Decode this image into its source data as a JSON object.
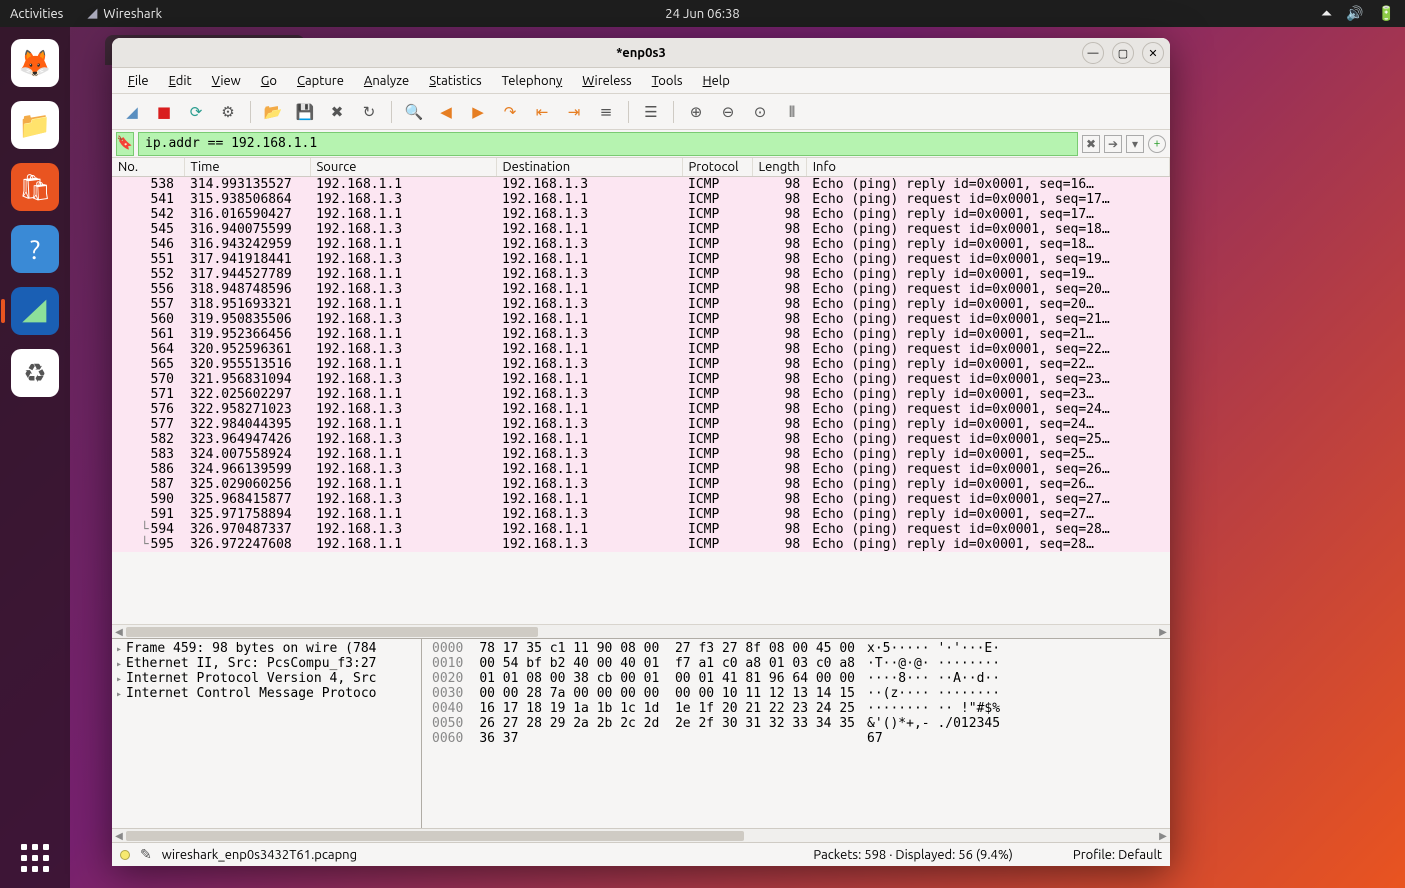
{
  "gnome": {
    "activities": "Activities",
    "app_name": "Wireshark",
    "clock": "24 Jun  06:38"
  },
  "window": {
    "title": "*enp0s3"
  },
  "menu": {
    "file": "File",
    "edit": "Edit",
    "view": "View",
    "go": "Go",
    "capture": "Capture",
    "analyze": "Analyze",
    "statistics": "Statistics",
    "telephony": "Telephony",
    "wireless": "Wireless",
    "tools": "Tools",
    "help": "Help"
  },
  "filter": {
    "value": "ip.addr == 192.168.1.1"
  },
  "headers": {
    "no": "No.",
    "time": "Time",
    "source": "Source",
    "destination": "Destination",
    "protocol": "Protocol",
    "length": "Length",
    "info": "Info"
  },
  "packets": [
    {
      "no": "538",
      "time": "314.993135527",
      "src": "192.168.1.1",
      "dst": "192.168.1.3",
      "proto": "ICMP",
      "len": "98",
      "info": "Echo (ping) reply    id=0x0001, seq=16…"
    },
    {
      "no": "541",
      "time": "315.938506864",
      "src": "192.168.1.3",
      "dst": "192.168.1.1",
      "proto": "ICMP",
      "len": "98",
      "info": "Echo (ping) request  id=0x0001, seq=17…"
    },
    {
      "no": "542",
      "time": "316.016590427",
      "src": "192.168.1.1",
      "dst": "192.168.1.3",
      "proto": "ICMP",
      "len": "98",
      "info": "Echo (ping) reply    id=0x0001, seq=17…"
    },
    {
      "no": "545",
      "time": "316.940075599",
      "src": "192.168.1.3",
      "dst": "192.168.1.1",
      "proto": "ICMP",
      "len": "98",
      "info": "Echo (ping) request  id=0x0001, seq=18…"
    },
    {
      "no": "546",
      "time": "316.943242959",
      "src": "192.168.1.1",
      "dst": "192.168.1.3",
      "proto": "ICMP",
      "len": "98",
      "info": "Echo (ping) reply    id=0x0001, seq=18…"
    },
    {
      "no": "551",
      "time": "317.941918441",
      "src": "192.168.1.3",
      "dst": "192.168.1.1",
      "proto": "ICMP",
      "len": "98",
      "info": "Echo (ping) request  id=0x0001, seq=19…"
    },
    {
      "no": "552",
      "time": "317.944527789",
      "src": "192.168.1.1",
      "dst": "192.168.1.3",
      "proto": "ICMP",
      "len": "98",
      "info": "Echo (ping) reply    id=0x0001, seq=19…"
    },
    {
      "no": "556",
      "time": "318.948748596",
      "src": "192.168.1.3",
      "dst": "192.168.1.1",
      "proto": "ICMP",
      "len": "98",
      "info": "Echo (ping) request  id=0x0001, seq=20…"
    },
    {
      "no": "557",
      "time": "318.951693321",
      "src": "192.168.1.1",
      "dst": "192.168.1.3",
      "proto": "ICMP",
      "len": "98",
      "info": "Echo (ping) reply    id=0x0001, seq=20…"
    },
    {
      "no": "560",
      "time": "319.950835506",
      "src": "192.168.1.3",
      "dst": "192.168.1.1",
      "proto": "ICMP",
      "len": "98",
      "info": "Echo (ping) request  id=0x0001, seq=21…"
    },
    {
      "no": "561",
      "time": "319.952366456",
      "src": "192.168.1.1",
      "dst": "192.168.1.3",
      "proto": "ICMP",
      "len": "98",
      "info": "Echo (ping) reply    id=0x0001, seq=21…"
    },
    {
      "no": "564",
      "time": "320.952596361",
      "src": "192.168.1.3",
      "dst": "192.168.1.1",
      "proto": "ICMP",
      "len": "98",
      "info": "Echo (ping) request  id=0x0001, seq=22…"
    },
    {
      "no": "565",
      "time": "320.955513516",
      "src": "192.168.1.1",
      "dst": "192.168.1.3",
      "proto": "ICMP",
      "len": "98",
      "info": "Echo (ping) reply    id=0x0001, seq=22…"
    },
    {
      "no": "570",
      "time": "321.956831094",
      "src": "192.168.1.3",
      "dst": "192.168.1.1",
      "proto": "ICMP",
      "len": "98",
      "info": "Echo (ping) request  id=0x0001, seq=23…"
    },
    {
      "no": "571",
      "time": "322.025602297",
      "src": "192.168.1.1",
      "dst": "192.168.1.3",
      "proto": "ICMP",
      "len": "98",
      "info": "Echo (ping) reply    id=0x0001, seq=23…"
    },
    {
      "no": "576",
      "time": "322.958271023",
      "src": "192.168.1.3",
      "dst": "192.168.1.1",
      "proto": "ICMP",
      "len": "98",
      "info": "Echo (ping) request  id=0x0001, seq=24…"
    },
    {
      "no": "577",
      "time": "322.984044395",
      "src": "192.168.1.1",
      "dst": "192.168.1.3",
      "proto": "ICMP",
      "len": "98",
      "info": "Echo (ping) reply    id=0x0001, seq=24…"
    },
    {
      "no": "582",
      "time": "323.964947426",
      "src": "192.168.1.3",
      "dst": "192.168.1.1",
      "proto": "ICMP",
      "len": "98",
      "info": "Echo (ping) request  id=0x0001, seq=25…"
    },
    {
      "no": "583",
      "time": "324.007558924",
      "src": "192.168.1.1",
      "dst": "192.168.1.3",
      "proto": "ICMP",
      "len": "98",
      "info": "Echo (ping) reply    id=0x0001, seq=25…"
    },
    {
      "no": "586",
      "time": "324.966139599",
      "src": "192.168.1.3",
      "dst": "192.168.1.1",
      "proto": "ICMP",
      "len": "98",
      "info": "Echo (ping) request  id=0x0001, seq=26…"
    },
    {
      "no": "587",
      "time": "325.029060256",
      "src": "192.168.1.1",
      "dst": "192.168.1.3",
      "proto": "ICMP",
      "len": "98",
      "info": "Echo (ping) reply    id=0x0001, seq=26…"
    },
    {
      "no": "590",
      "time": "325.968415877",
      "src": "192.168.1.3",
      "dst": "192.168.1.1",
      "proto": "ICMP",
      "len": "98",
      "info": "Echo (ping) request  id=0x0001, seq=27…"
    },
    {
      "no": "591",
      "time": "325.971758894",
      "src": "192.168.1.1",
      "dst": "192.168.1.3",
      "proto": "ICMP",
      "len": "98",
      "info": "Echo (ping) reply    id=0x0001, seq=27…"
    },
    {
      "no": "594",
      "time": "326.970487337",
      "src": "192.168.1.3",
      "dst": "192.168.1.1",
      "proto": "ICMP",
      "len": "98",
      "info": "Echo (ping) request  id=0x0001, seq=28…",
      "corner": true
    },
    {
      "no": "595",
      "time": "326.972247608",
      "src": "192.168.1.1",
      "dst": "192.168.1.3",
      "proto": "ICMP",
      "len": "98",
      "info": "Echo (ping) reply    id=0x0001, seq=28…",
      "corner": true
    }
  ],
  "details": [
    "Frame 459: 98 bytes on wire (784",
    "Ethernet II, Src: PcsCompu_f3:27",
    "Internet Protocol Version 4, Src",
    "Internet Control Message Protoco"
  ],
  "hex": {
    "offsets": [
      "0000",
      "0010",
      "0020",
      "0030",
      "0040",
      "0050",
      "0060"
    ],
    "bytes": [
      "78 17 35 c1 11 90 08 00  27 f3 27 8f 08 00 45 00",
      "00 54 bf b2 40 00 40 01  f7 a1 c0 a8 01 03 c0 a8",
      "01 01 08 00 38 cb 00 01  00 01 41 81 96 64 00 00",
      "00 00 28 7a 00 00 00 00  00 00 10 11 12 13 14 15",
      "16 17 18 19 1a 1b 1c 1d  1e 1f 20 21 22 23 24 25",
      "26 27 28 29 2a 2b 2c 2d  2e 2f 30 31 32 33 34 35",
      "36 37"
    ],
    "ascii": [
      "x·5····· '·'···E·",
      "·T··@·@· ········",
      "····8··· ··A··d··",
      "··(z···· ········",
      "········ ·· !\"#$%",
      "&'()*+,- ./012345",
      "67"
    ]
  },
  "status": {
    "file": "wireshark_enp0s3432T61.pcapng",
    "packets": "Packets: 598 · Displayed: 56 (9.4%)",
    "profile": "Profile: Default"
  }
}
